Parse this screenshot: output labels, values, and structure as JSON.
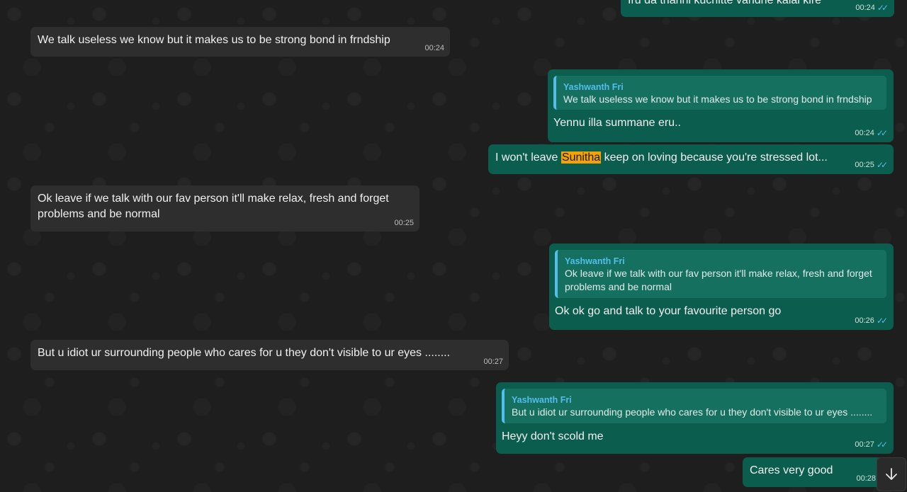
{
  "messages": [
    {
      "id": "m0",
      "direction": "out",
      "text": "Iru da thanni kuchitte vandhe kalai kire",
      "time": "00:24",
      "read": true
    },
    {
      "id": "m1",
      "direction": "in",
      "text": "We talk useless we know but it makes us to be strong bond in frndship",
      "time": "00:24"
    },
    {
      "id": "m2",
      "direction": "out",
      "quote_name": "Yashwanth Fri",
      "quote_text": "We talk useless we know but it makes us to be strong bond in frndship",
      "text": "Yennu illa summane eru..",
      "time": "00:24",
      "read": true
    },
    {
      "id": "m3",
      "direction": "out",
      "text_before": "I won't leave ",
      "highlight": "Sunitha",
      "text_after": " keep on loving because you're stressed lot...",
      "time": "00:25",
      "read": true
    },
    {
      "id": "m4",
      "direction": "in",
      "text": "Ok leave if we talk with our fav person it'll make relax, fresh and forget problems and be normal",
      "time": "00:25"
    },
    {
      "id": "m5",
      "direction": "out",
      "quote_name": "Yashwanth Fri",
      "quote_text": "Ok leave if we talk with our fav person it'll make relax, fresh and forget problems and be normal",
      "text": "Ok ok go and talk to your favourite person go",
      "time": "00:26",
      "read": true
    },
    {
      "id": "m6",
      "direction": "in",
      "text": "But u idiot ur surrounding people who cares for u they don't visible to ur eyes ........",
      "time": "00:27"
    },
    {
      "id": "m7",
      "direction": "out",
      "quote_name": "Yashwanth Fri",
      "quote_text": "But u idiot ur surrounding people who cares for u they don't visible to ur eyes ........",
      "text": "Heyy don't scold me",
      "time": "00:27",
      "read": true
    },
    {
      "id": "m8",
      "direction": "out",
      "text": "Cares very good",
      "time": "00:28"
    }
  ],
  "icons": {
    "read_ticks": "double-check-icon",
    "scroll_down": "arrow-down-icon"
  },
  "colors": {
    "incoming_bubble": "#2e2e2e",
    "outgoing_bubble": "#0b5d4d",
    "quote_accent": "#53bdeb",
    "highlight": "#f5a300"
  }
}
